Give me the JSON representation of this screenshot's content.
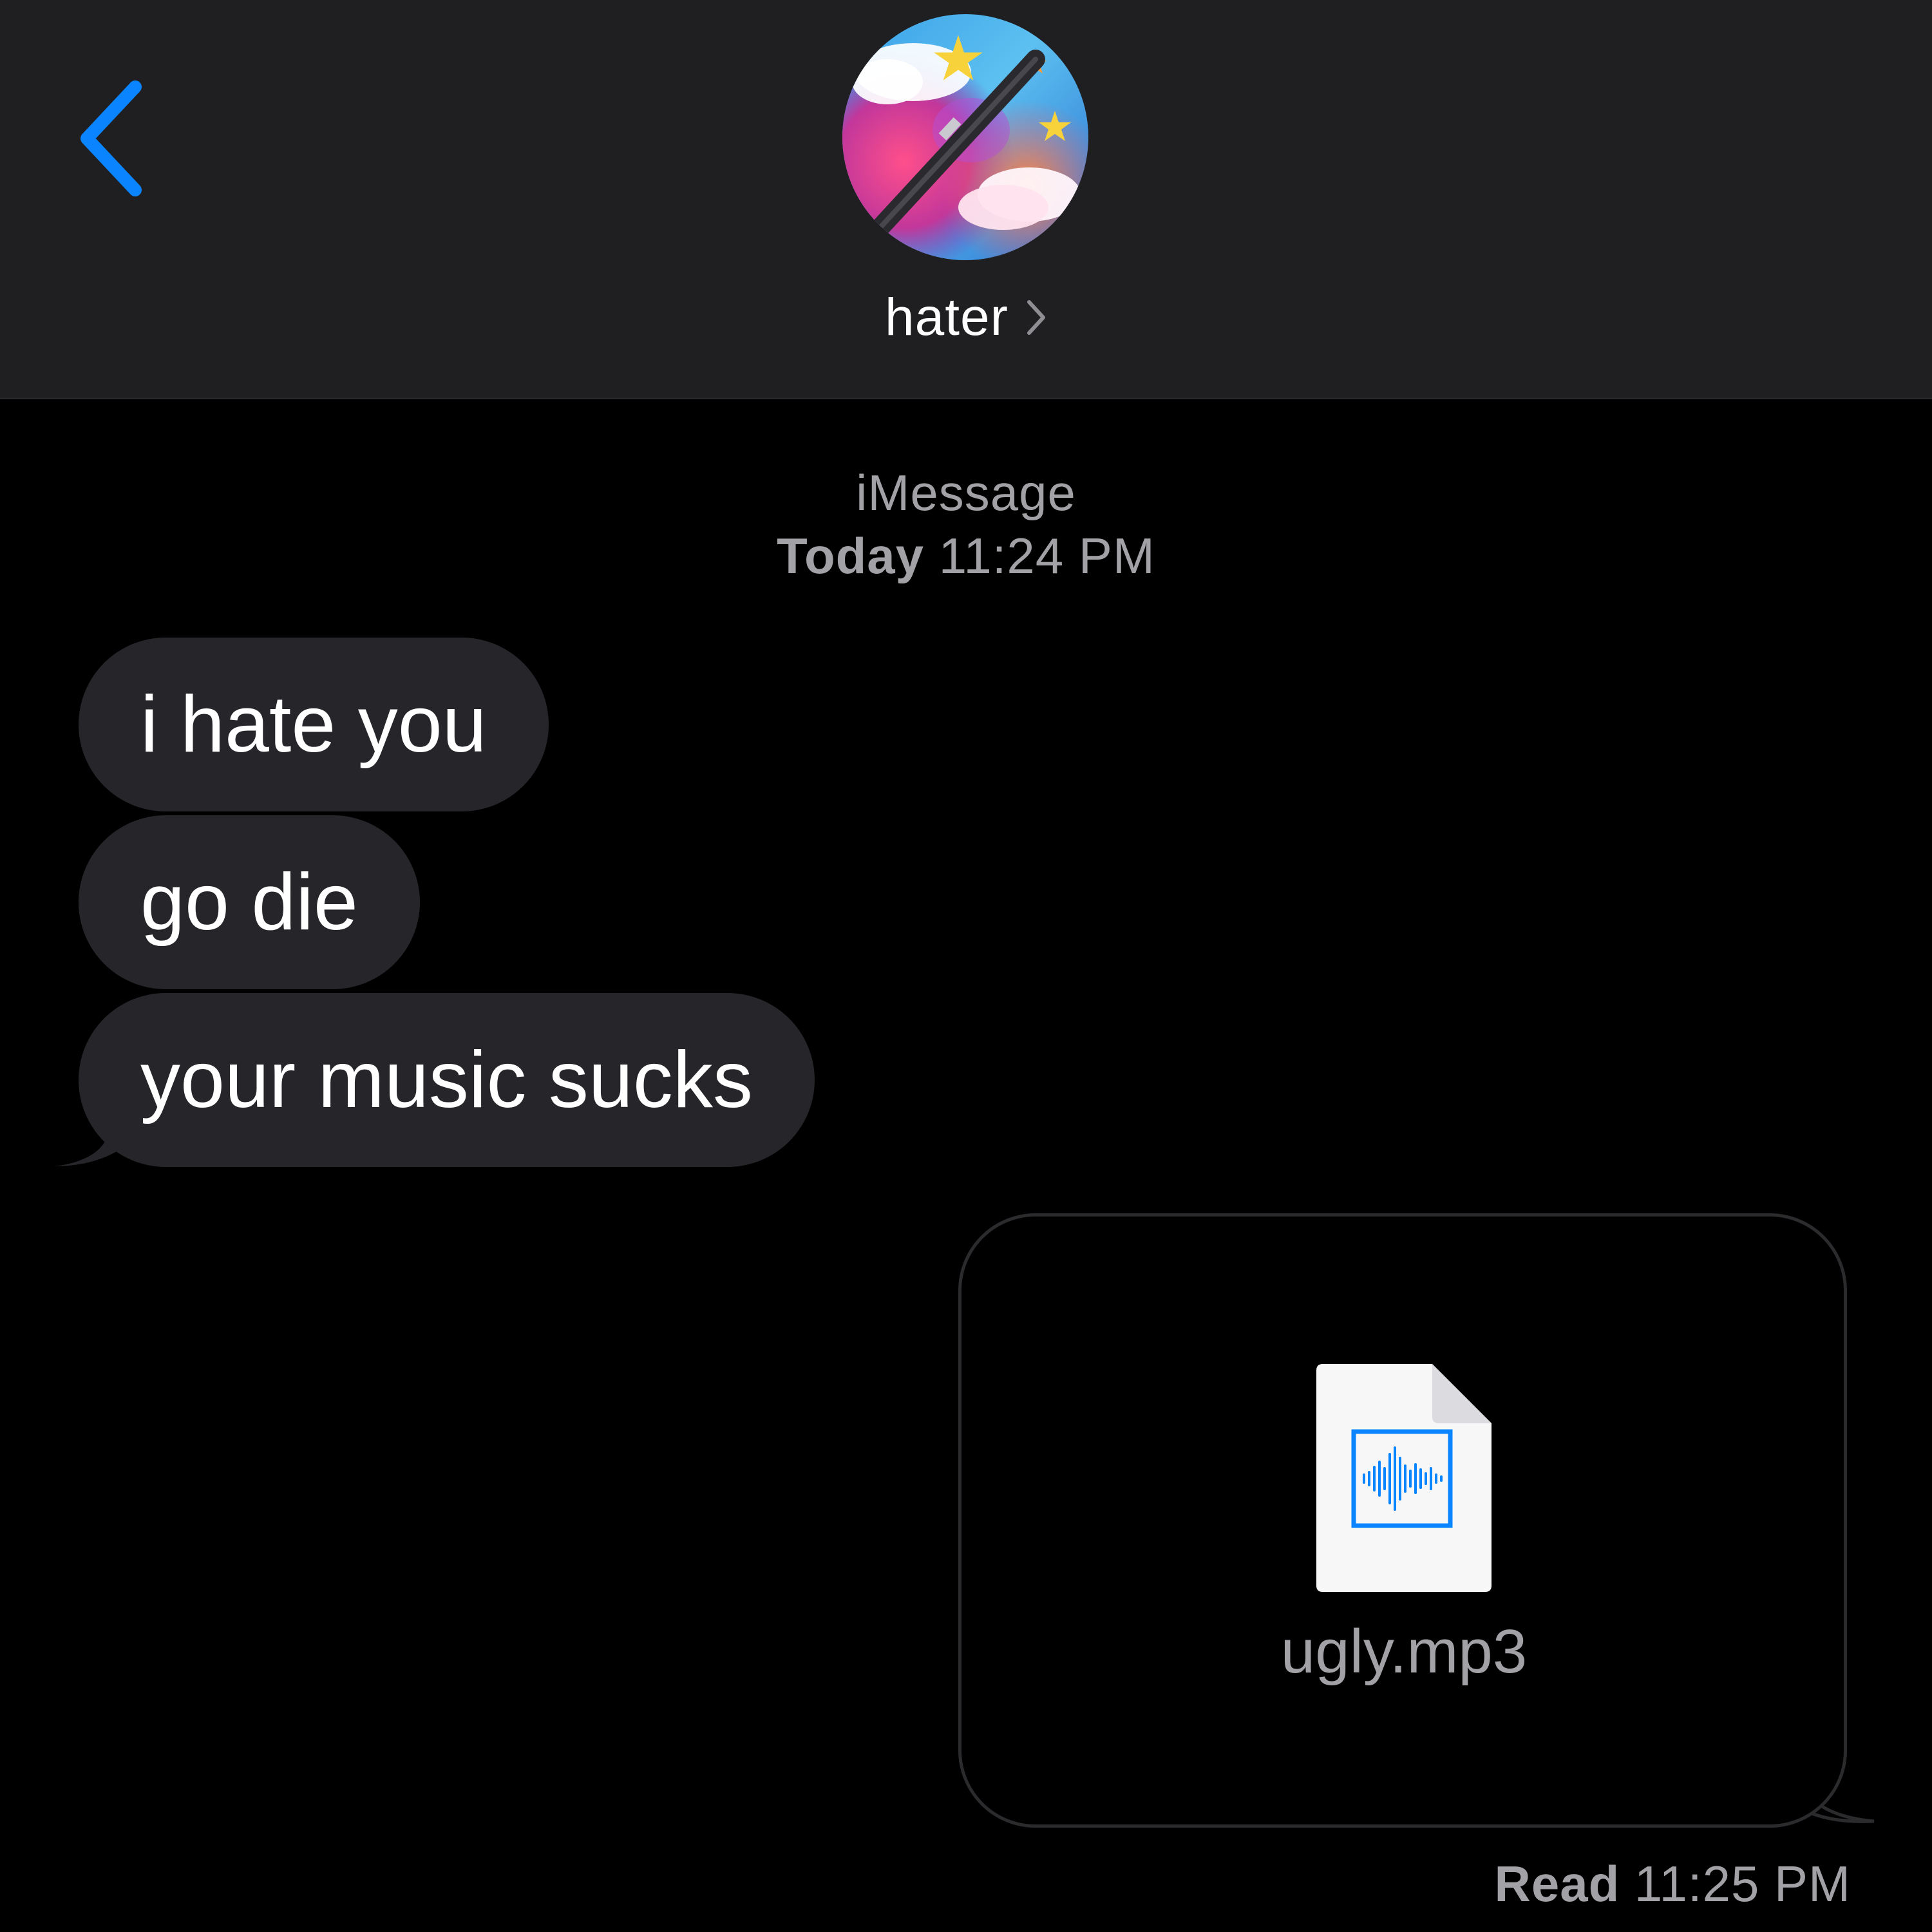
{
  "header": {
    "contact_name": "hater",
    "back_icon": "chevron-left-icon",
    "detail_icon": "chevron-right-icon",
    "accent_color": "#0a84ff"
  },
  "thread": {
    "service": "iMessage",
    "date_label": "Today",
    "time": "11:24 PM"
  },
  "messages": [
    {
      "direction": "incoming",
      "text": "i hate you"
    },
    {
      "direction": "incoming",
      "text": "go die"
    },
    {
      "direction": "incoming",
      "text": "your music sucks"
    }
  ],
  "attachment": {
    "direction": "outgoing",
    "file_name": "ugly.mp3",
    "icon": "audio-file-icon"
  },
  "receipt": {
    "status": "Read",
    "time": "11:25 PM"
  },
  "colors": {
    "header_bg": "#1f1f21",
    "incoming_bubble": "#26262a",
    "meta_text": "#a1a1a6",
    "background": "#000000"
  }
}
